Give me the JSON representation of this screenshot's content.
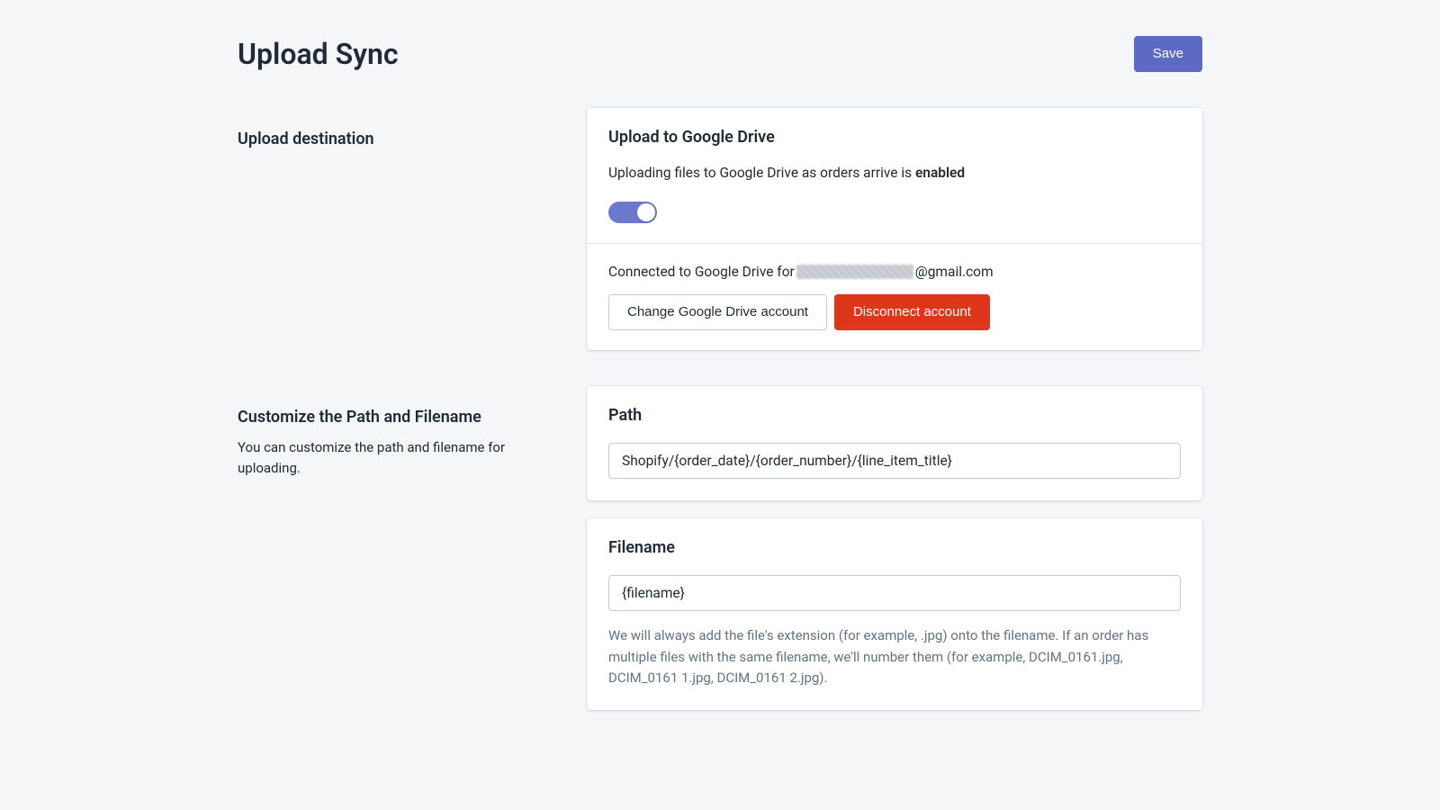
{
  "header": {
    "title": "Upload Sync",
    "save_label": "Save"
  },
  "destination": {
    "side_title": "Upload destination",
    "card_title": "Upload to Google Drive",
    "status_prefix": "Uploading files to Google Drive as orders arrive is ",
    "status_word": "enabled",
    "toggle_on": true,
    "connected_prefix": "Connected to Google Drive for ",
    "connected_suffix": "@gmail.com",
    "change_account_label": "Change Google Drive account",
    "disconnect_label": "Disconnect account"
  },
  "customize": {
    "side_title": "Customize the Path and Filename",
    "side_desc": "You can customize the path and filename for uploading."
  },
  "path": {
    "title": "Path",
    "value": "Shopify/{order_date}/{order_number}/{line_item_title}"
  },
  "filename": {
    "title": "Filename",
    "value": "{filename}",
    "help_text": "We will always add the file's extension (for example, .jpg) onto the filename. If an order has multiple files with the same filename, we'll number them (for example, DCIM_0161.jpg, DCIM_0161 1.jpg, DCIM_0161 2.jpg)."
  }
}
